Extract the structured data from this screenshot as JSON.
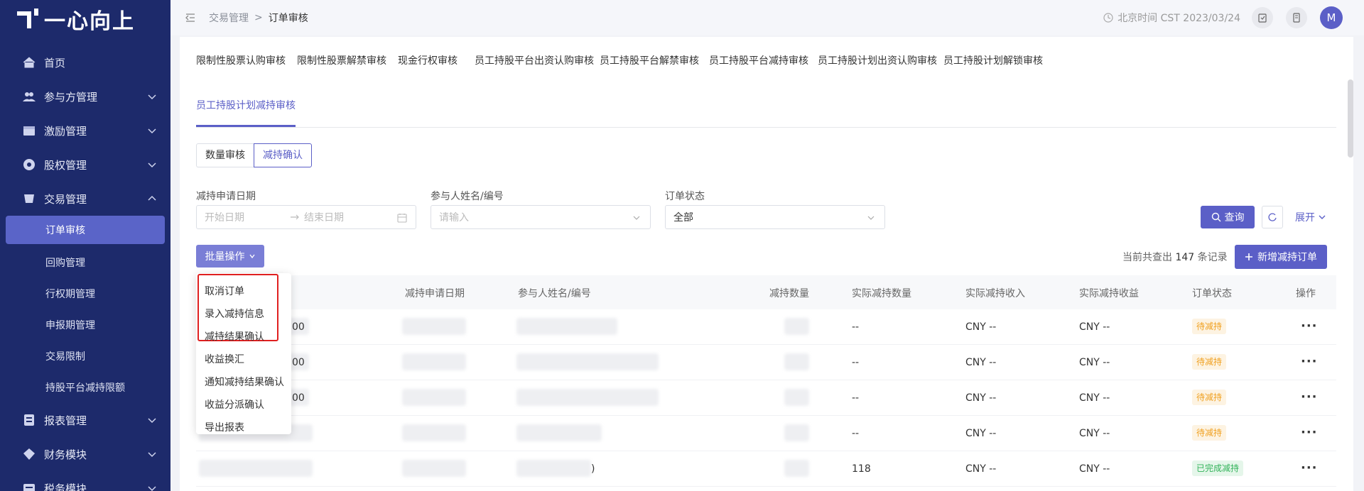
{
  "sidebar": {
    "logo": "一心向上",
    "items": [
      {
        "label": "首页"
      },
      {
        "label": "参与方管理"
      },
      {
        "label": "激励管理"
      },
      {
        "label": "股权管理"
      },
      {
        "label": "交易管理"
      }
    ],
    "subitems": [
      {
        "label": "订单审核"
      },
      {
        "label": "回购管理"
      },
      {
        "label": "行权期管理"
      },
      {
        "label": "申报期管理"
      },
      {
        "label": "交易限制"
      },
      {
        "label": "持股平台减持限额"
      }
    ],
    "after": [
      {
        "label": "报表管理"
      },
      {
        "label": "财务模块"
      },
      {
        "label": "税务模块"
      }
    ]
  },
  "header": {
    "crumb_parent": "交易管理",
    "crumb_sep": ">",
    "crumb_current": "订单审核",
    "time": "北京时间 CST 2023/03/24",
    "avatar": "M"
  },
  "tabs": [
    "限制性股票认购审核",
    "限制性股票解禁审核",
    "现金行权审核",
    "员工持股平台出资认购审核",
    "员工持股平台解禁审核",
    "员工持股平台减持审核",
    "员工持股计划出资认购审核",
    "员工持股计划解锁审核",
    "员工持股计划减持审核"
  ],
  "segments": [
    "数量审核",
    "减持确认"
  ],
  "filters": {
    "date_label": "减持申请日期",
    "start_placeholder": "开始日期",
    "end_placeholder": "结束日期",
    "name_label": "参与人姓名/编号",
    "name_placeholder": "请输入",
    "status_label": "订单状态",
    "status_value": "全部",
    "query": "查询",
    "expand": "展开"
  },
  "toolbar": {
    "batch": "批量操作",
    "count_prefix": "当前共查出",
    "count_value": "147",
    "count_suffix": "条记录",
    "new_order": "新增减持订单"
  },
  "table": {
    "columns": [
      "减持申请日期",
      "参与人姓名/编号",
      "减持数量",
      "实际减持数量",
      "实际减持收入",
      "实际减持收益",
      "订单状态",
      "操作"
    ],
    "rows": [
      {
        "id_tail": "00",
        "actual_qty": "--",
        "income": "CNY --",
        "gain": "CNY --",
        "status": "待减持",
        "name_tail": ""
      },
      {
        "id_tail": "00",
        "actual_qty": "--",
        "income": "CNY --",
        "gain": "CNY --",
        "status": "待减持",
        "name_tail": ""
      },
      {
        "id_tail": "00",
        "actual_qty": "--",
        "income": "CNY --",
        "gain": "CNY --",
        "status": "待减持",
        "name_tail": ""
      },
      {
        "id_tail": "",
        "actual_qty": "--",
        "income": "CNY --",
        "gain": "CNY --",
        "status": "待减持",
        "name_tail": ""
      },
      {
        "id_tail": "",
        "actual_qty": "118",
        "income": "CNY --",
        "gain": "CNY --",
        "status": "已完成减持",
        "name_tail": ")"
      }
    ]
  },
  "menu": [
    "取消订单",
    "录入减持信息",
    "减持结果确认",
    "收益换汇",
    "通知减持结果确认",
    "收益分派确认",
    "导出报表"
  ],
  "colors": {
    "sidebar": "#1d2a6b",
    "accent": "#5b5fc7",
    "highlight": "#e02020"
  }
}
